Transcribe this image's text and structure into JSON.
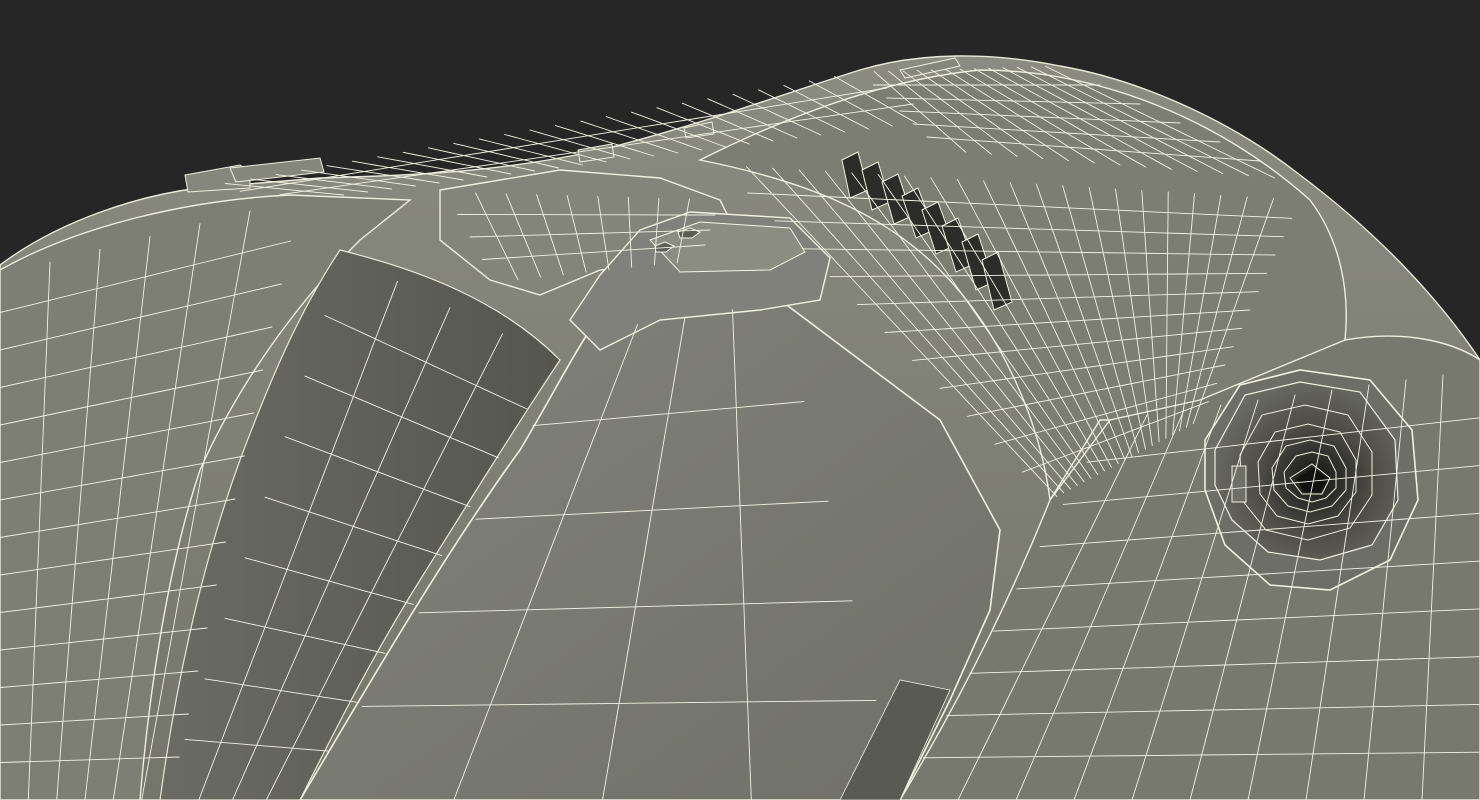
{
  "scene": {
    "background_color": "#262626",
    "shell_color": "#7b7c72",
    "shell_shadow_color": "#5f6057",
    "shell_dark_color": "#4a4a43",
    "wire_color": "#f2f2e4",
    "cavity_color": "#2a2a26"
  }
}
